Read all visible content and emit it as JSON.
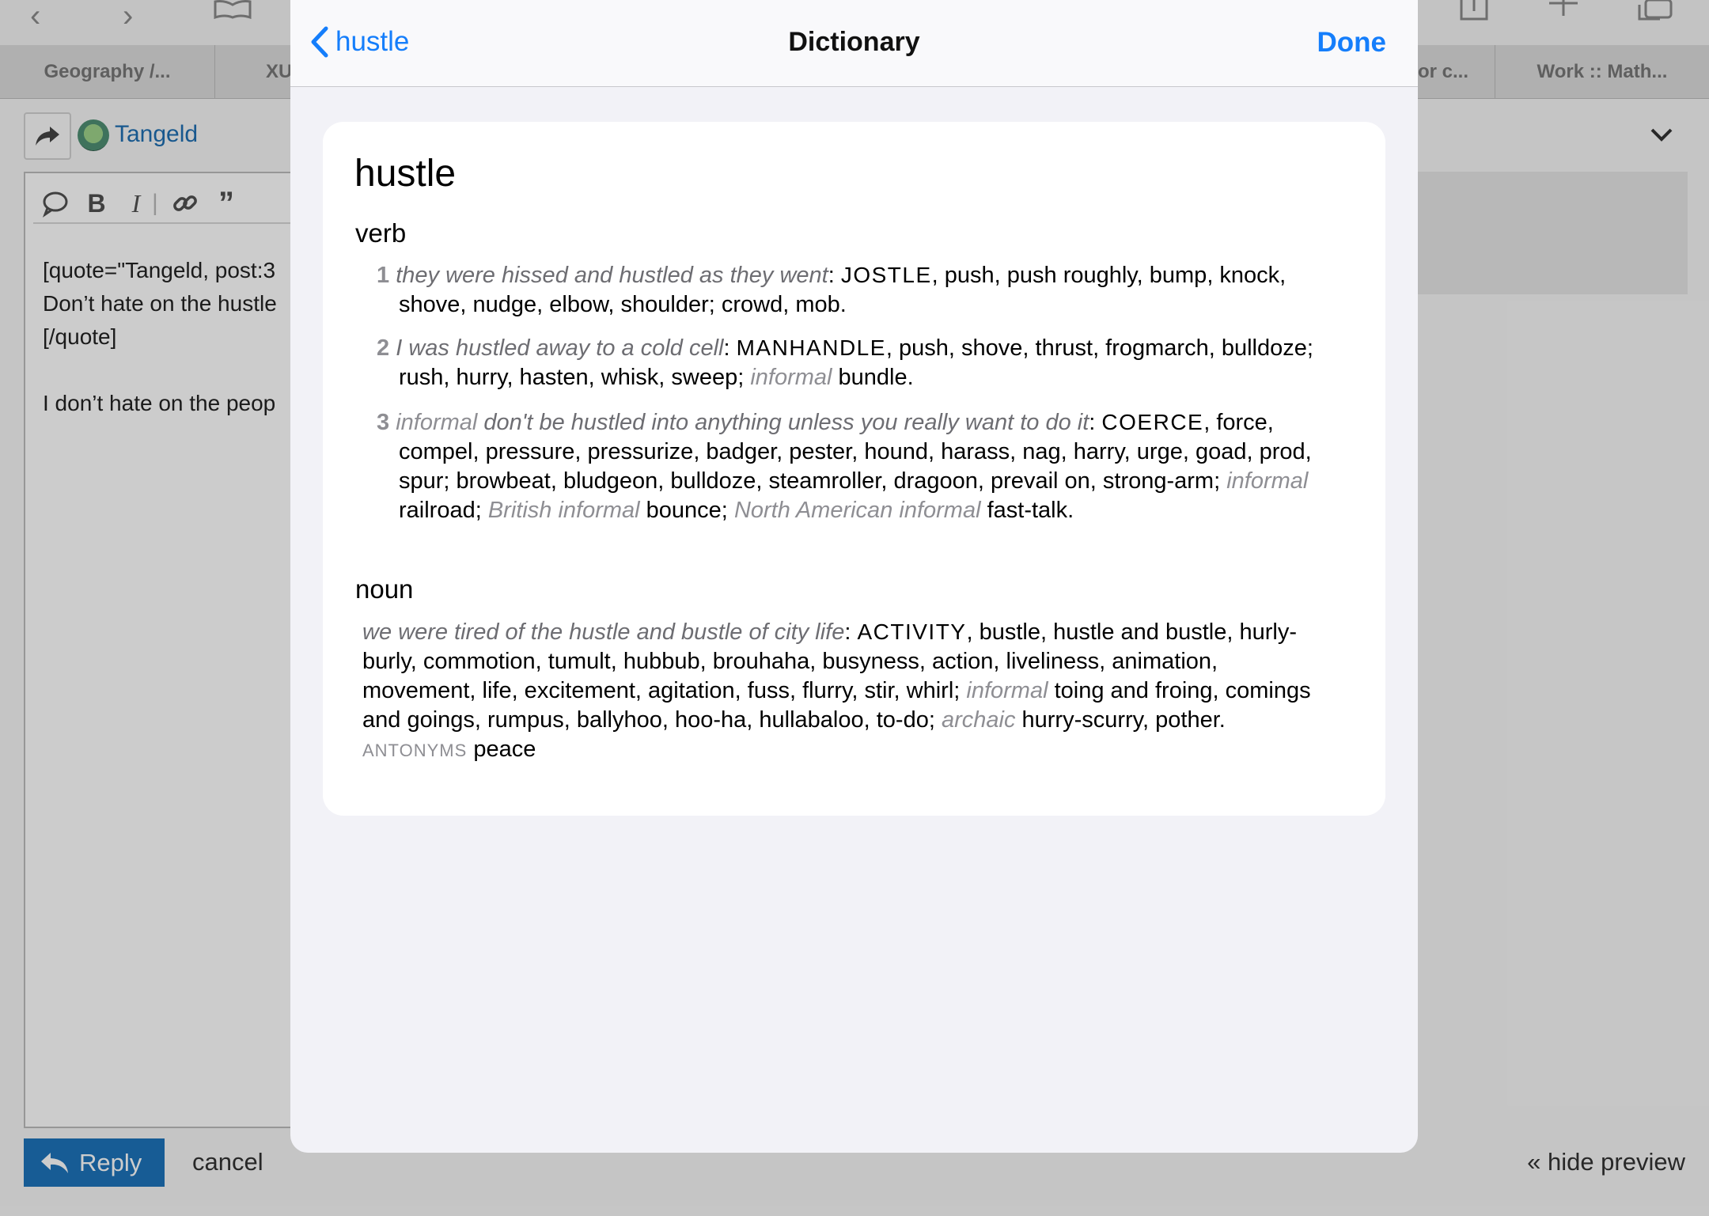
{
  "browser": {
    "tabs": [
      "Geography /...",
      "XU",
      "or c...",
      "Work :: Math..."
    ]
  },
  "post": {
    "username": "Tangeld",
    "editor_lines": [
      "[quote=\"Tangeld, post:3",
      "Don’t hate on the hustle",
      "[/quote]",
      "",
      "I don’t hate on the peop"
    ],
    "reply_label": "Reply",
    "cancel_label": "cancel",
    "hide_preview_label": "« hide preview"
  },
  "dictionary": {
    "back_label": "hustle",
    "title": "Dictionary",
    "done_label": "Done",
    "headword": "hustle",
    "verb": {
      "pos": "verb",
      "senses": [
        {
          "num": "1",
          "example": "they were hissed and hustled as they went",
          "keyword": "JOSTLE",
          "line1_rest": ", push, push roughly, bump, knock,",
          "line2": "shove, nudge, elbow, shoulder; crowd, mob."
        },
        {
          "num": "2",
          "example": "I was hustled away to a cold cell",
          "keyword": "MANHANDLE",
          "line1_rest": ", push, shove, thrust, frogmarch, bulldoze;",
          "line2_pre": "rush, hurry, hasten, whisk, sweep; ",
          "line2_reg": "informal",
          "line2_post": " bundle."
        },
        {
          "num": "3",
          "register": "informal",
          "example": "don't be hustled into anything unless you really want to do it",
          "keyword": "COERCE",
          "line1_rest": ", force,",
          "line2": "compel, pressure, pressurize, badger, pester, hound, harass, nag, harry, urge, goad, prod,",
          "line3_pre": "spur; browbeat, bludgeon, bulldoze, steamroller, dragoon, prevail on, strong-arm; ",
          "line3_reg": "informal",
          "line4_a": "railroad; ",
          "line4_reg1": "British informal",
          "line4_b": " bounce; ",
          "line4_reg2": "North American informal",
          "line4_c": " fast-talk."
        }
      ]
    },
    "noun": {
      "pos": "noun",
      "example": "we were tired of the hustle and bustle of city life",
      "keyword": "ACTIVITY",
      "line1_rest": ", bustle, hustle and bustle, hurly-",
      "line2": "burly, commotion, tumult, hubbub, brouhaha, busyness, action, liveliness, animation,",
      "line3_pre": "movement, life, excitement, agitation, fuss, flurry, stir, whirl; ",
      "line3_reg": "informal",
      "line3_post": " toing and froing, comings",
      "line4_pre": "and goings, rumpus, ballyhoo, hoo-ha, hullabaloo, to-do; ",
      "line4_reg": "archaic",
      "line4_post": " hurry-scurry, pother.",
      "antonyms_label": "ANTONYMS",
      "antonyms": "peace"
    }
  }
}
